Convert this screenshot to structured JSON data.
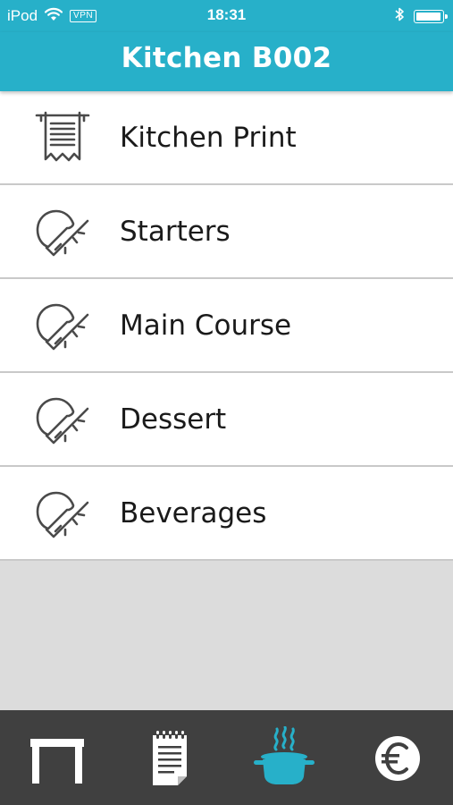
{
  "status_bar": {
    "carrier": "iPod",
    "vpn": "VPN",
    "time": "18:31",
    "battery_level": 1.0,
    "icons": [
      "wifi-icon",
      "bluetooth-icon",
      "battery-icon"
    ]
  },
  "header": {
    "title": "Kitchen B002"
  },
  "menu": {
    "items": [
      {
        "label": "Kitchen Print",
        "icon": "receipt-print-icon"
      },
      {
        "label": "Starters",
        "icon": "service-bell-icon"
      },
      {
        "label": "Main Course",
        "icon": "service-bell-icon"
      },
      {
        "label": "Dessert",
        "icon": "service-bell-icon"
      },
      {
        "label": "Beverages",
        "icon": "service-bell-icon"
      }
    ]
  },
  "tab_bar": {
    "tabs": [
      {
        "icon": "table-icon",
        "active": false
      },
      {
        "icon": "order-notepad-icon",
        "active": false
      },
      {
        "icon": "cooking-pot-icon",
        "active": true
      },
      {
        "icon": "euro-icon",
        "active": false
      }
    ]
  },
  "colors": {
    "accent": "#27b0c9",
    "tab_bar_bg": "#404040",
    "tab_icon": "#ffffff",
    "list_background": "#dcdcdc",
    "divider": "#c9c9c9"
  }
}
